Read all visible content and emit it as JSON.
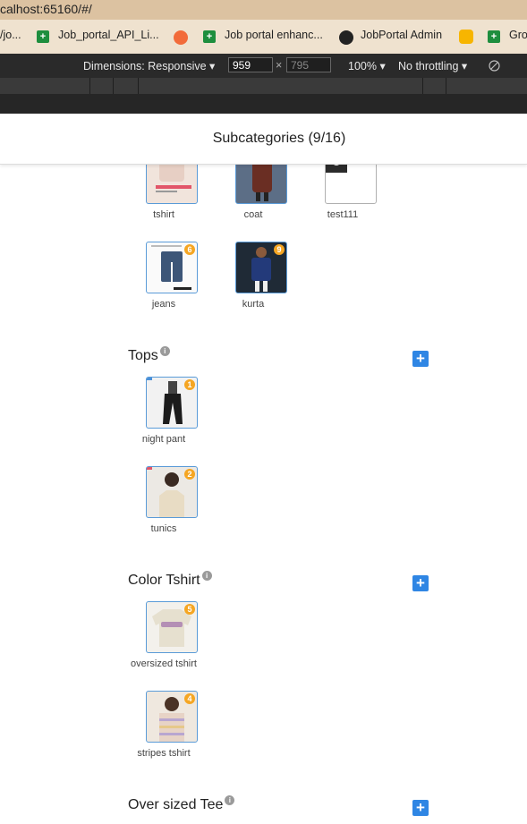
{
  "browser": {
    "address": "calhost:65160/#/",
    "bookmarks": [
      {
        "label": "/jo..."
      },
      {
        "label": "Job_portal_API_Li..."
      },
      {
        "label": "Job portal enhanc..."
      },
      {
        "label": "JobPortal Admin"
      },
      {
        "label": "Gro"
      }
    ]
  },
  "devtools": {
    "dimensions_label": "Dimensions: Responsive",
    "width": "959",
    "height": "795",
    "times": "×",
    "zoom": "100%",
    "throttling": "No throttling"
  },
  "page": {
    "title": "Subcategories (9/16)",
    "add_glyph": "+",
    "info_glyph": "i",
    "items": [
      {
        "label": "tshirt"
      },
      {
        "label": "coat"
      },
      {
        "label": "test111"
      },
      {
        "label": "jeans",
        "badge": "6"
      },
      {
        "label": "kurta",
        "badge": "9"
      }
    ],
    "categories": [
      {
        "name": "Tops",
        "items": [
          {
            "label": "night pant",
            "badge": "1"
          },
          {
            "label": "tunics",
            "badge": "2"
          }
        ]
      },
      {
        "name": "Color Tshirt",
        "items": [
          {
            "label": "oversized tshirt",
            "badge": "5"
          },
          {
            "label": "stripes tshirt",
            "badge": "4"
          }
        ]
      },
      {
        "name": "Over sized Tee",
        "items": []
      }
    ]
  },
  "colors": {
    "accent": "#2f86e4",
    "badge": "#f5a623",
    "thumb_border": "#5a9bd8"
  }
}
